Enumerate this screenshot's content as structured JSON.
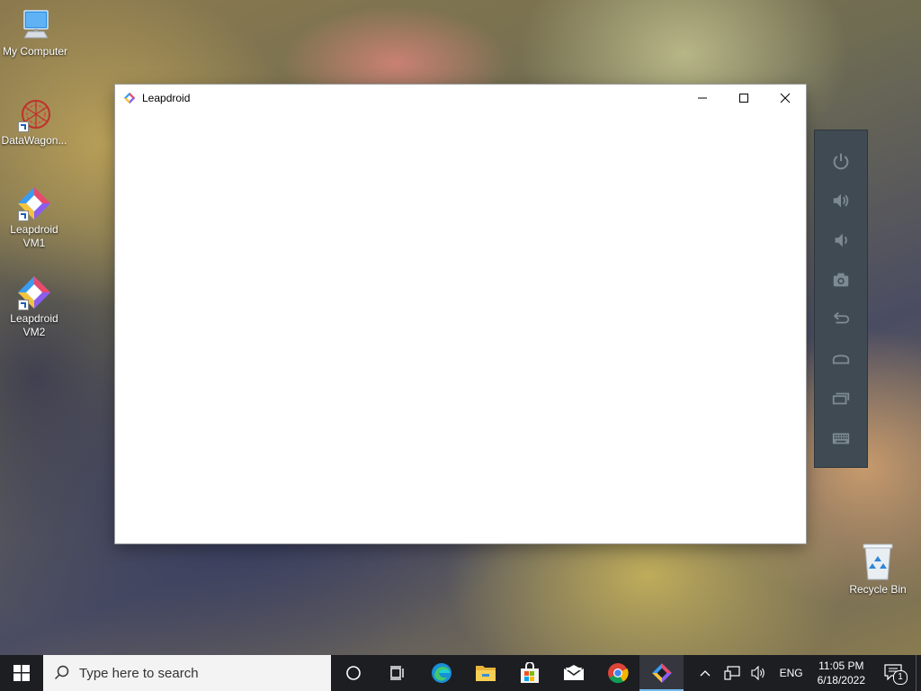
{
  "desktop": {
    "icons": [
      {
        "label": "My Computer",
        "icon": "computer-icon"
      },
      {
        "label": "DataWagon...",
        "icon": "datawagon-icon"
      },
      {
        "label": "Leapdroid VM1",
        "icon": "leapdroid-icon"
      },
      {
        "label": "Leapdroid VM2",
        "icon": "leapdroid-icon"
      }
    ],
    "recycle_bin": {
      "label": "Recycle Bin",
      "icon": "recycle-bin-icon"
    }
  },
  "window": {
    "title": "Leapdroid",
    "controls": [
      "minimize-icon",
      "maximize-icon",
      "close-icon"
    ]
  },
  "side_toolbar": {
    "buttons": [
      "power-icon",
      "volume-up-icon",
      "volume-down-icon",
      "camera-icon",
      "back-icon",
      "home-icon",
      "recent-apps-icon",
      "keyboard-icon"
    ],
    "color": "#3f4a52",
    "icon_color": "#7e8a93"
  },
  "taskbar": {
    "search_placeholder": "Type here to search",
    "pinned": [
      "cortana-icon",
      "task-view-icon",
      "edge-icon",
      "file-explorer-icon",
      "store-icon",
      "mail-icon",
      "chrome-icon",
      "leapdroid-icon"
    ],
    "active_app": "leapdroid-icon",
    "tray": {
      "icons": [
        "chevron-up-icon",
        "network-icon",
        "volume-icon"
      ],
      "language": "ENG",
      "time": "11:05 PM",
      "date": "6/18/2022",
      "notification_count": "1"
    }
  }
}
